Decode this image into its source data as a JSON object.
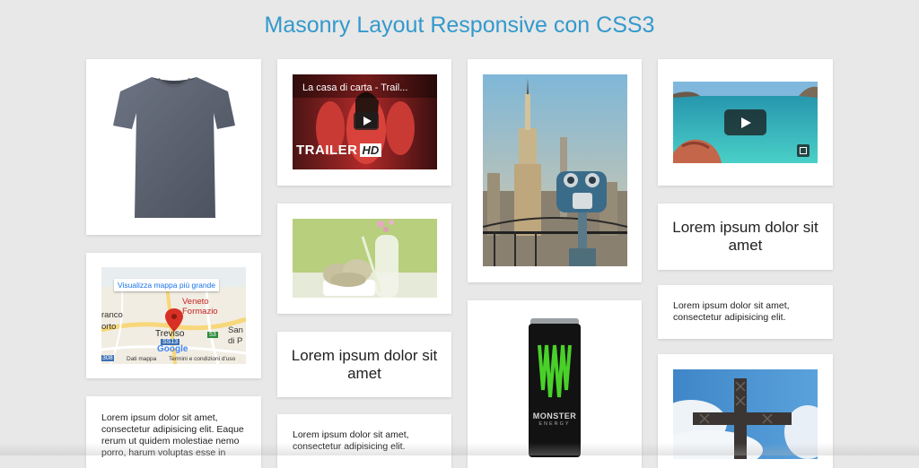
{
  "page": {
    "title": "Masonry Layout Responsive con CSS3"
  },
  "cards": {
    "tshirt": {
      "icon": "tshirt-image"
    },
    "video1": {
      "title": "La casa di carta - Trail...",
      "badge_trailer": "TRAILER",
      "badge_hd": "HD"
    },
    "map": {
      "link": "Visualizza mappa più grande",
      "place_label": "Veneto Formazio",
      "city": "Treviso",
      "left_label": "ranco",
      "left_label2": "orto",
      "right_label": "San",
      "right_label2": "di P",
      "road_left": "SS13",
      "road_right": "53",
      "road_bottom": "308",
      "logo": "Google",
      "footer_data": "Dati mappa",
      "footer_terms": "Termini e condizioni d'uso"
    },
    "text_long": {
      "text": "Lorem ipsum dolor sit amet, consectetur adipisicing elit. Eaque rerum ut quidem molestiae nemo porro, harum voluptas esse in"
    },
    "icecream": {
      "icon": "icecream-image"
    },
    "heading_mid": {
      "text": "Lorem ipsum dolor sit amet"
    },
    "text_mid": {
      "text": "Lorem ipsum dolor sit amet, consectetur adipisicing elit."
    },
    "building": {
      "icon": "empire-state-image"
    },
    "can": {
      "brand": "MONSTER",
      "sub": "ENERGY"
    },
    "video2": {
      "icon": "sea-video-image"
    },
    "heading_right": {
      "text": "Lorem ipsum dolor sit amet"
    },
    "text_right": {
      "text": "Lorem ipsum dolor sit amet, consectetur adipisicing elit."
    },
    "cross": {
      "icon": "cross-image"
    }
  },
  "colors": {
    "title": "#3399cc",
    "background": "#e8e8e8",
    "card": "#ffffff",
    "map_pin": "#d93025"
  }
}
